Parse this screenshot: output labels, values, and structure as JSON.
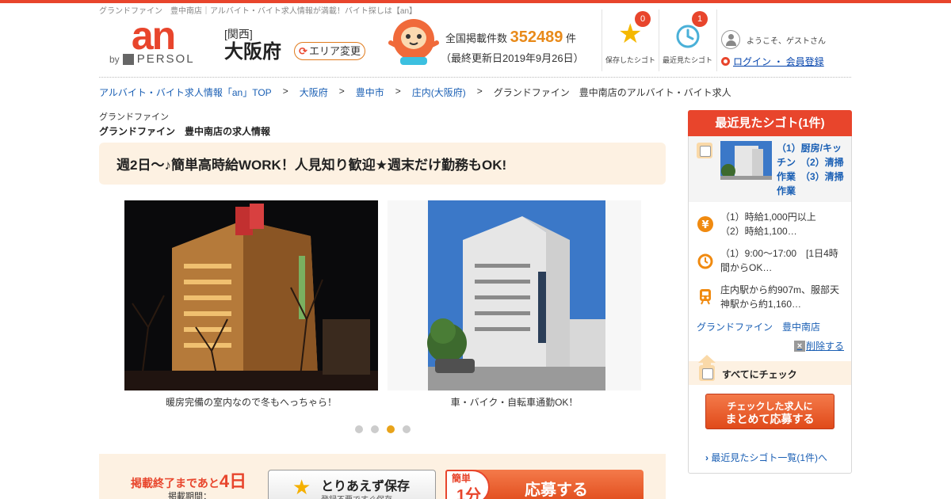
{
  "seo_line": "グランドファイン　豊中南店｜アルバイト・バイト求人情報が満載！バイト探しは【an】",
  "logo": {
    "brand": "an",
    "by": "by",
    "persol": "PERSOL"
  },
  "region": {
    "area": "[関西]",
    "pref": "大阪府",
    "change_label": "エリア変更"
  },
  "stats": {
    "label": "全国掲載件数",
    "count": "352489",
    "unit": "件",
    "updated": "（最終更新日2019年9月26日）"
  },
  "header_buttons": [
    {
      "label": "保存したシゴト",
      "badge": "0"
    },
    {
      "label": "最近見たシゴト",
      "badge": "1"
    }
  ],
  "user": {
    "welcome": "ようこそ、ゲストさん",
    "login": "ログイン ・ 会員登録"
  },
  "breadcrumb": [
    {
      "label": "アルバイト・バイト求人情報「an」TOP"
    },
    {
      "label": "大阪府"
    },
    {
      "label": "豊中市"
    },
    {
      "label": "庄内(大阪府)"
    },
    {
      "label": "グランドファイン　豊中南店のアルバイト・バイト求人"
    }
  ],
  "breadcrumb_sep": ">",
  "shop": {
    "name_small": "グランドファイン",
    "title": "グランドファイン　豊中南店の求人情報"
  },
  "catchcopy": "週2日～♪簡単高時給WORK！人見知り歓迎★週末だけ勤務もOK!",
  "photos": [
    {
      "caption": "暖房完備の室内なので冬もへっちゃら！"
    },
    {
      "caption": "車・バイク・自転車通勤OK！"
    }
  ],
  "carousel": {
    "total": 4,
    "active": 3
  },
  "apply": {
    "deadline_prefix": "掲載終了まであと",
    "deadline_days": "4日",
    "period_label": "掲載期間：",
    "save_title": "とりあえず保存",
    "save_sub": "登録不要ですぐ保存",
    "apply_tag_a": "簡単",
    "apply_tag_b": "1分",
    "apply_label": "応募する"
  },
  "sidebar": {
    "title": "最近見たシゴト(1件)",
    "jobs": "（1）厨房/キッチン　（2）清掃作業　（3）清掃作業",
    "wage_1": "（1）時給1,000円以上",
    "wage_2": "（2）時給1,100…",
    "hours": "（1）9:00～17:00　[1日4時間からOK…",
    "access": "庄内駅から約907m、服部天神駅から約1,160…",
    "shop_link": "グランドファイン　豊中南店",
    "delete": "削除する",
    "check_all": "すべてにチェック",
    "bulk_line1": "チェックした求人に",
    "bulk_line2": "まとめて応募する",
    "more": "最近見たシゴト一覧(1件)へ"
  },
  "colors": {
    "brand": "#e8452c",
    "accent": "#e88a1a",
    "link": "#1a5fb4",
    "cream": "#fdf1e2"
  }
}
